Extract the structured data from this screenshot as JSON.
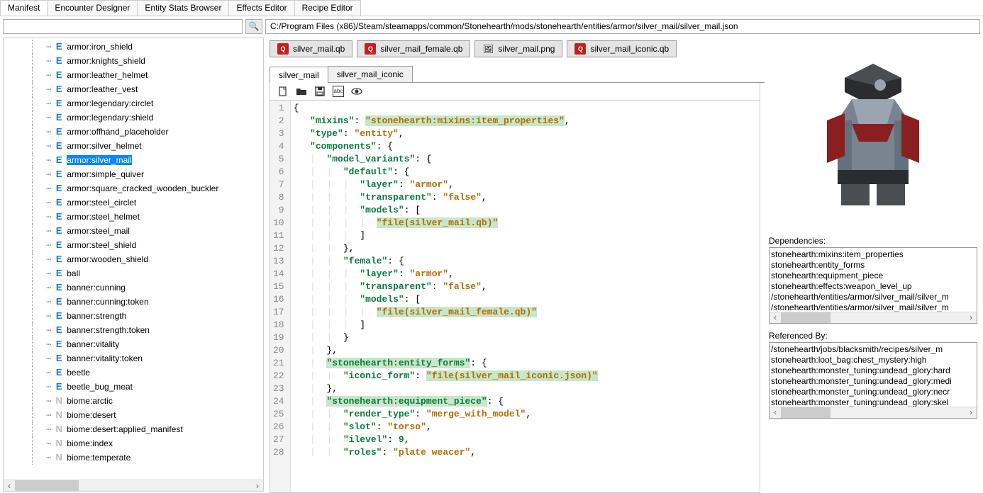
{
  "top_tabs": {
    "active": "Manifest",
    "items": [
      "Manifest",
      "Encounter Designer",
      "Entity Stats Browser",
      "Effects Editor",
      "Recipe Editor"
    ]
  },
  "search": {
    "value": "",
    "icon": "search-icon"
  },
  "path": "C:/Program Files (x86)/Steam/steamapps/common/Stonehearth/mods/stonehearth/entities/armor/silver_mail/silver_mail.json",
  "tree": {
    "selected": "armor:silver_mail",
    "items": [
      {
        "icon": "E",
        "label": "armor:iron_shield"
      },
      {
        "icon": "E",
        "label": "armor:knights_shield"
      },
      {
        "icon": "E",
        "label": "armor:leather_helmet"
      },
      {
        "icon": "E",
        "label": "armor:leather_vest"
      },
      {
        "icon": "E",
        "label": "armor:legendary:circlet"
      },
      {
        "icon": "E",
        "label": "armor:legendary:shield"
      },
      {
        "icon": "E",
        "label": "armor:offhand_placeholder"
      },
      {
        "icon": "E",
        "label": "armor:silver_helmet"
      },
      {
        "icon": "E",
        "label": "armor:silver_mail"
      },
      {
        "icon": "E",
        "label": "armor:simple_quiver"
      },
      {
        "icon": "E",
        "label": "armor:square_cracked_wooden_buckler"
      },
      {
        "icon": "E",
        "label": "armor:steel_circlet"
      },
      {
        "icon": "E",
        "label": "armor:steel_helmet"
      },
      {
        "icon": "E",
        "label": "armor:steel_mail"
      },
      {
        "icon": "E",
        "label": "armor:steel_shield"
      },
      {
        "icon": "E",
        "label": "armor:wooden_shield"
      },
      {
        "icon": "E",
        "label": "ball"
      },
      {
        "icon": "E",
        "label": "banner:cunning"
      },
      {
        "icon": "E",
        "label": "banner:cunning:token"
      },
      {
        "icon": "E",
        "label": "banner:strength"
      },
      {
        "icon": "E",
        "label": "banner:strength:token"
      },
      {
        "icon": "E",
        "label": "banner:vitality"
      },
      {
        "icon": "E",
        "label": "banner:vitality:token"
      },
      {
        "icon": "E",
        "label": "beetle"
      },
      {
        "icon": "E",
        "label": "beetle_bug_meat"
      },
      {
        "icon": "N",
        "label": "biome:arctic"
      },
      {
        "icon": "N",
        "label": "biome:desert"
      },
      {
        "icon": "N",
        "label": "biome:desert:applied_manifest"
      },
      {
        "icon": "N",
        "label": "biome:index"
      },
      {
        "icon": "N",
        "label": "biome:temperate"
      }
    ]
  },
  "file_tabs": [
    {
      "icon": "qb",
      "label": "silver_mail.qb"
    },
    {
      "icon": "qb",
      "label": "silver_mail_female.qb"
    },
    {
      "icon": "png",
      "label": "silver_mail.png"
    },
    {
      "icon": "qb",
      "label": "silver_mail_iconic.qb"
    }
  ],
  "sub_tabs": {
    "active": "silver_mail",
    "items": [
      "silver_mail",
      "silver_mail_iconic"
    ]
  },
  "toolbar_icons": [
    "new-file-icon",
    "open-folder-icon",
    "save-icon",
    "localize-icon",
    "preview-icon"
  ],
  "code": {
    "lines": [
      {
        "n": 1,
        "html": "{"
      },
      {
        "n": 2,
        "html": "   <span class='tok-key'>\"mixins\"</span>: <span class='tok-hl tok-str'>\"stonehearth:mixins:item_properties\"</span>,"
      },
      {
        "n": 3,
        "html": "   <span class='tok-key'>\"type\"</span>: <span class='tok-str'>\"entity\"</span>,"
      },
      {
        "n": 4,
        "html": "   <span class='tok-key'>\"components\"</span>: {"
      },
      {
        "n": 5,
        "html": "   <span class='guide'>|</span>  <span class='tok-key'>\"model_variants\"</span>: {"
      },
      {
        "n": 6,
        "html": "   <span class='guide'>|</span>  <span class='guide'>|</span>  <span class='tok-key'>\"default\"</span>: {"
      },
      {
        "n": 7,
        "html": "   <span class='guide'>|</span>  <span class='guide'>|</span>  <span class='guide'>|</span>  <span class='tok-key'>\"layer\"</span>: <span class='tok-str'>\"armor\"</span>,"
      },
      {
        "n": 8,
        "html": "   <span class='guide'>|</span>  <span class='guide'>|</span>  <span class='guide'>|</span>  <span class='tok-key'>\"transparent\"</span>: <span class='tok-str'>\"false\"</span>,"
      },
      {
        "n": 9,
        "html": "   <span class='guide'>|</span>  <span class='guide'>|</span>  <span class='guide'>|</span>  <span class='tok-key'>\"models\"</span>: ["
      },
      {
        "n": 10,
        "html": "   <span class='guide'>|</span>  <span class='guide'>|</span>  <span class='guide'>|</span>  <span class='guide'>|</span>  <span class='tok-hl tok-str'>\"file(silver_mail.qb)\"</span>"
      },
      {
        "n": 11,
        "html": "   <span class='guide'>|</span>  <span class='guide'>|</span>  <span class='guide'>|</span>  ]"
      },
      {
        "n": 12,
        "html": "   <span class='guide'>|</span>  <span class='guide'>|</span>  },"
      },
      {
        "n": 13,
        "html": "   <span class='guide'>|</span>  <span class='guide'>|</span>  <span class='tok-key'>\"female\"</span>: {"
      },
      {
        "n": 14,
        "html": "   <span class='guide'>|</span>  <span class='guide'>|</span>  <span class='guide'>|</span>  <span class='tok-key'>\"layer\"</span>: <span class='tok-str'>\"armor\"</span>,"
      },
      {
        "n": 15,
        "html": "   <span class='guide'>|</span>  <span class='guide'>|</span>  <span class='guide'>|</span>  <span class='tok-key'>\"transparent\"</span>: <span class='tok-str'>\"false\"</span>,"
      },
      {
        "n": 16,
        "html": "   <span class='guide'>|</span>  <span class='guide'>|</span>  <span class='guide'>|</span>  <span class='tok-key'>\"models\"</span>: ["
      },
      {
        "n": 17,
        "html": "   <span class='guide'>|</span>  <span class='guide'>|</span>  <span class='guide'>|</span>  <span class='guide'>|</span>  <span class='tok-hl tok-str'>\"file(silver_mail_female.qb)\"</span>"
      },
      {
        "n": 18,
        "html": "   <span class='guide'>|</span>  <span class='guide'>|</span>  <span class='guide'>|</span>  ]"
      },
      {
        "n": 19,
        "html": "   <span class='guide'>|</span>  <span class='guide'>|</span>  }"
      },
      {
        "n": 20,
        "html": "   <span class='guide'>|</span>  },"
      },
      {
        "n": 21,
        "html": "   <span class='guide'>|</span>  <span class='tok-hl tok-key'>\"stonehearth:entity_forms\"</span>: {"
      },
      {
        "n": 22,
        "html": "   <span class='guide'>|</span>  <span class='guide'>|</span>  <span class='tok-key'>\"iconic_form\"</span>: <span class='tok-hl tok-str'>\"file(silver_mail_iconic.json)\"</span>"
      },
      {
        "n": 23,
        "html": "   <span class='guide'>|</span>  },"
      },
      {
        "n": 24,
        "html": "   <span class='guide'>|</span>  <span class='tok-hl tok-key'>\"stonehearth:equipment_piece\"</span>: {"
      },
      {
        "n": 25,
        "html": "   <span class='guide'>|</span>  <span class='guide'>|</span>  <span class='tok-key'>\"render_type\"</span>: <span class='tok-str'>\"merge_with_model\"</span>,"
      },
      {
        "n": 26,
        "html": "   <span class='guide'>|</span>  <span class='guide'>|</span>  <span class='tok-key'>\"slot\"</span>: <span class='tok-str'>\"torso\"</span>,"
      },
      {
        "n": 27,
        "html": "   <span class='guide'>|</span>  <span class='guide'>|</span>  <span class='tok-key'>\"ilevel\"</span>: <span class='tok-num'>9</span>,"
      },
      {
        "n": 28,
        "html": "   <span class='guide'>|</span>  <span class='guide'>|</span>  <span class='tok-key'>\"roles\"</span>: <span class='tok-str'>\"plate weacer\"</span>,"
      }
    ]
  },
  "dependencies": {
    "label": "Dependencies:",
    "items": [
      "stonehearth:mixins:item_properties",
      "stonehearth:entity_forms",
      "stonehearth:equipment_piece",
      "stonehearth:effects:weapon_level_up",
      "/stonehearth/entities/armor/silver_mail/silver_m",
      "/stonehearth/entities/armor/silver_mail/silver_m"
    ]
  },
  "referenced_by": {
    "label": "Referenced By:",
    "items": [
      "/stonehearth/jobs/blacksmith/recipes/silver_m",
      "stonehearth:loot_bag:chest_mystery:high",
      "stonehearth:monster_tuning:undead_glory:hard",
      "stonehearth:monster_tuning:undead_glory:medi",
      "stonehearth:monster_tuning:undead_glory:necr",
      "stonehearth:monster_tuning:undead_glory:skel"
    ]
  }
}
